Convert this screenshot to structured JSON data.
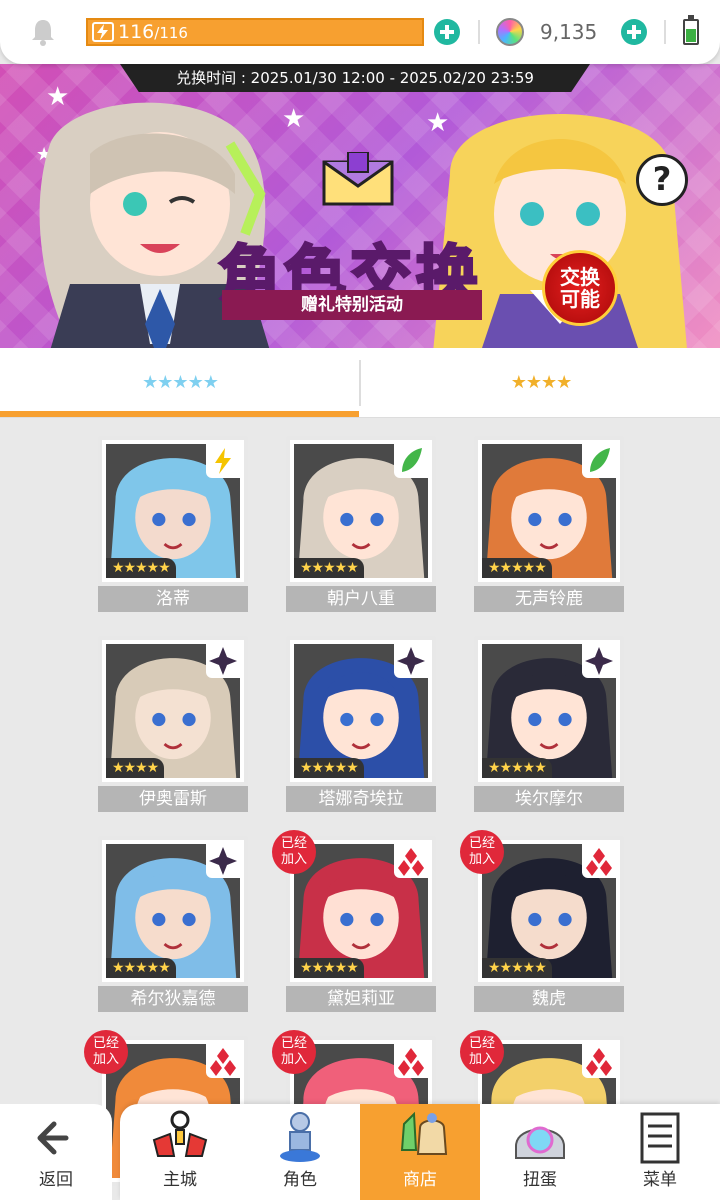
{
  "status_bar": {
    "stamina_current": "116",
    "stamina_max": "/116",
    "gem_count": "9,135",
    "battery_level": 0.6
  },
  "banner": {
    "period": "兑换时间 : 2025.01/30 12:00 - 2025.02/20 23:59",
    "title": "角色交换",
    "subtitle": "赠礼特别活动",
    "badge_line1": "交换",
    "badge_line2": "可能",
    "help_label": "?"
  },
  "tabs": [
    {
      "label": "★★★★★",
      "active": true,
      "color": "#7fd0f0"
    },
    {
      "label": "★★★★",
      "active": false,
      "color": "#f1b02a"
    }
  ],
  "characters": [
    {
      "name": "洛蒂",
      "stars": "★★★★★",
      "element": "lightning",
      "owned": false
    },
    {
      "name": "朝户八重",
      "stars": "★★★★★",
      "element": "leaf",
      "owned": false
    },
    {
      "name": "无声铃鹿",
      "stars": "★★★★★",
      "element": "leaf",
      "owned": false
    },
    {
      "name": "伊奥雷斯",
      "stars": "★★★★",
      "element": "dark",
      "owned": false
    },
    {
      "name": "塔娜奇埃拉",
      "stars": "★★★★★",
      "element": "dark",
      "owned": false
    },
    {
      "name": "埃尔摩尔",
      "stars": "★★★★★",
      "element": "dark",
      "owned": false
    },
    {
      "name": "希尔狄嘉德",
      "stars": "★★★★★",
      "element": "dark",
      "owned": false
    },
    {
      "name": "黛妲莉亚",
      "stars": "★★★★★",
      "element": "fire",
      "owned": true
    },
    {
      "name": "魏虎",
      "stars": "★★★★★",
      "element": "fire",
      "owned": true
    },
    {
      "name": "",
      "stars": "",
      "element": "fire",
      "owned": true
    },
    {
      "name": "",
      "stars": "",
      "element": "fire",
      "owned": true
    },
    {
      "name": "",
      "stars": "",
      "element": "fire",
      "owned": true
    }
  ],
  "owned_label_1": "已经",
  "owned_label_2": "加入",
  "nav": {
    "back": "返回",
    "items": [
      "主城",
      "角色",
      "商店",
      "扭蛋",
      "菜单"
    ]
  }
}
